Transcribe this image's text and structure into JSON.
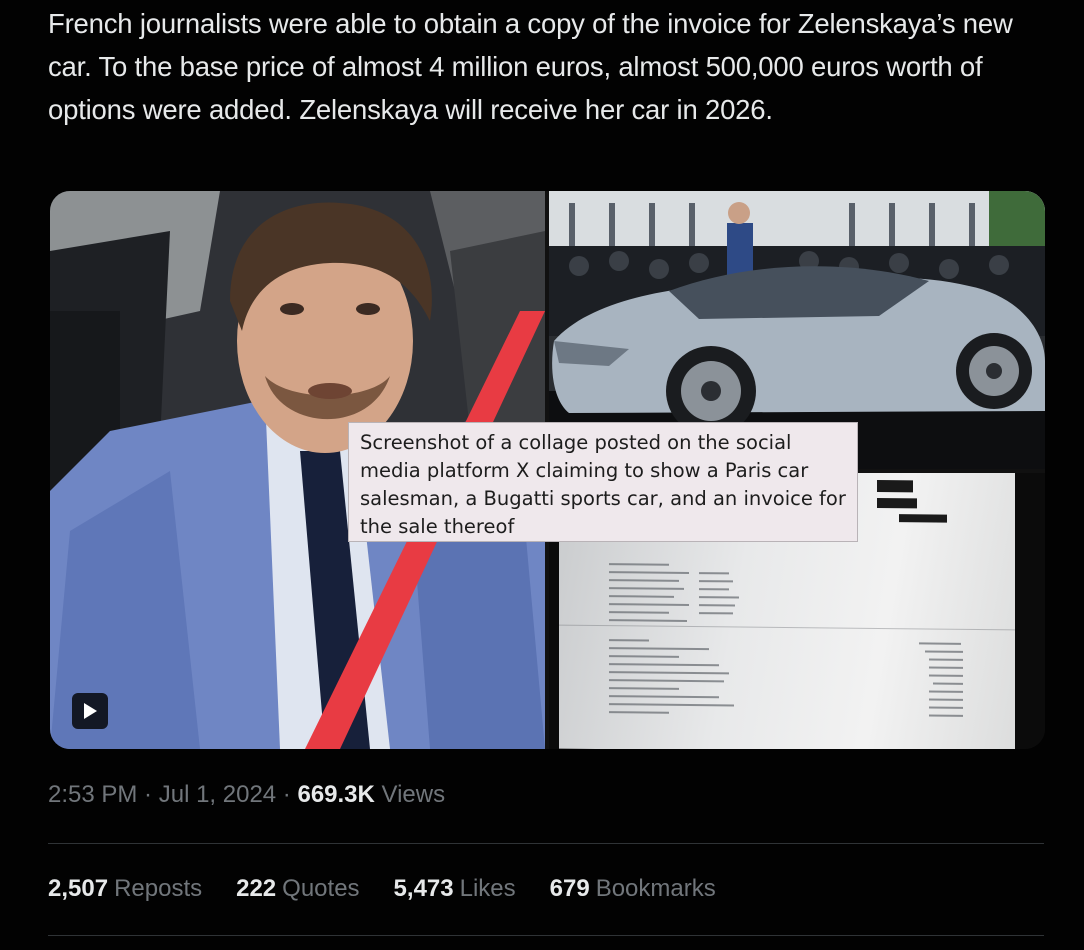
{
  "tweet": {
    "text": "French journalists were able to obtain a copy of the invoice for Zelenskaya’s new car. To the base price of almost 4 million euros, almost 500,000 euros worth of options were added. Zelenskaya will receive her car in 2026."
  },
  "media": {
    "icons": [
      "play-icon"
    ]
  },
  "caption": {
    "text": "Screenshot of a collage posted on the social media platform X claiming to show a Paris car salesman, a Bugatti sports car, and an invoice for the sale thereof"
  },
  "meta": {
    "time": "2:53 PM",
    "sep1": " · ",
    "date": "Jul 1, 2024",
    "sep2": " · ",
    "views_count": "669.3K",
    "views_label": " Views"
  },
  "stats": {
    "reposts_count": "2,507",
    "reposts_label": "Reposts",
    "quotes_count": "222",
    "quotes_label": "Quotes",
    "likes_count": "5,473",
    "likes_label": "Likes",
    "bookmarks_count": "679",
    "bookmarks_label": "Bookmarks"
  },
  "colors": {
    "background": "#000000",
    "text_primary": "#e7e9ea",
    "text_secondary": "#71767b",
    "divider": "#2f3336",
    "caption_bg": "#efe8ec"
  }
}
